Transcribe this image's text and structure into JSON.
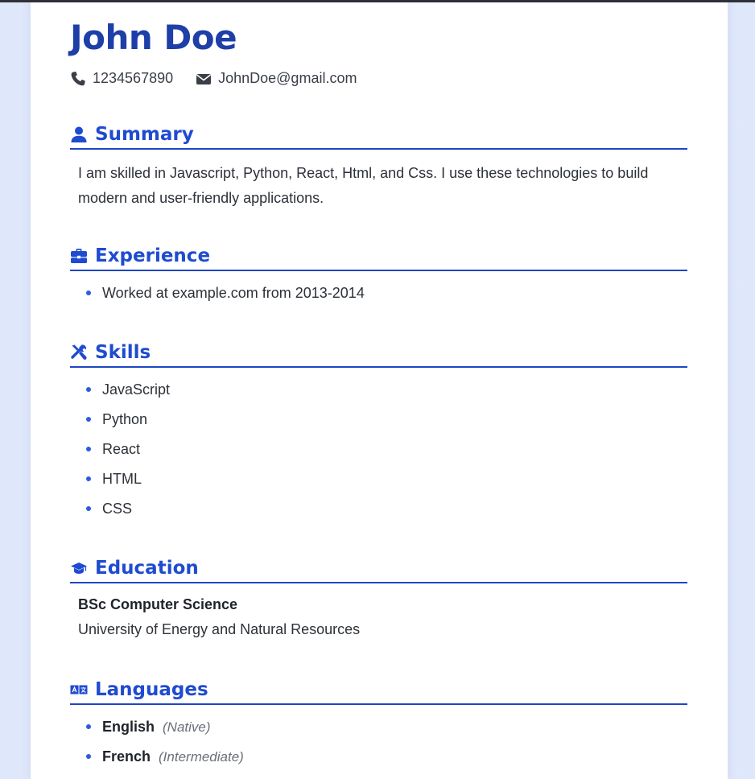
{
  "name": "John Doe",
  "contact": {
    "phone": "1234567890",
    "email": "JohnDoe@gmail.com",
    "phone_icon": "phone-icon",
    "email_icon": "envelope-icon"
  },
  "summary": {
    "title": "Summary",
    "icon": "user-icon",
    "text": "I am skilled in Javascript, Python, React, Html, and Css. I use these technologies to build modern and user-friendly applications."
  },
  "experience": {
    "title": "Experience",
    "icon": "briefcase-icon",
    "items": [
      "Worked at example.com from 2013-2014"
    ]
  },
  "skills": {
    "title": "Skills",
    "icon": "tools-icon",
    "items": [
      "JavaScript",
      "Python",
      "React",
      "HTML",
      "CSS"
    ]
  },
  "education": {
    "title": "Education",
    "icon": "graduation-cap-icon",
    "degree": "BSc Computer Science",
    "school": "University of Energy and Natural Resources"
  },
  "languages": {
    "title": "Languages",
    "icon": "language-icon",
    "items": [
      {
        "name": "English",
        "level": "(Native)"
      },
      {
        "name": "French",
        "level": "(Intermediate)"
      }
    ]
  },
  "colors": {
    "accent": "#1f4bd1",
    "name": "#1e3ea8",
    "bullet": "#2c5be0",
    "page_bg": "#e3eafc"
  }
}
